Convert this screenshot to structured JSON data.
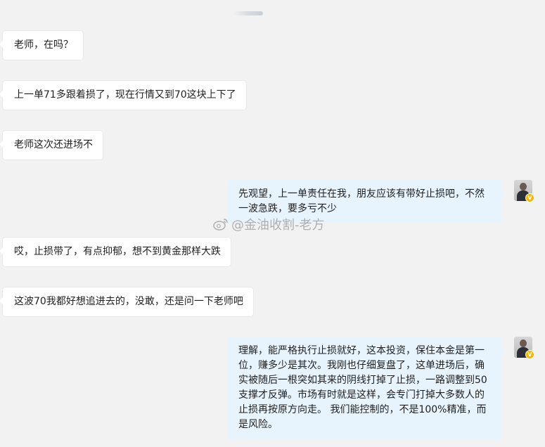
{
  "messages": [
    {
      "side": "left",
      "text": "老师，在吗？"
    },
    {
      "side": "left",
      "text": "上一单71多跟着损了，现在行情又到70这块上下了"
    },
    {
      "side": "left",
      "text": "老师这次还进场不"
    },
    {
      "side": "right",
      "text": "先观望，上一单责任在我，朋友应该有带好止损吧，不然一波急跌，要多亏不少"
    },
    {
      "side": "left",
      "text": "哎，止损带了，有点抑郁，想不到黄金那样大跌"
    },
    {
      "side": "left",
      "text": "这波70我都好想追进去的，没敢，还是问一下老师吧"
    },
    {
      "side": "right",
      "text": "理解，能严格执行止损就好，这本投资，保住本金是第一位，赚多少是其次。我刚也仔细复盘了，这单进场后，确实被随后一根突如其来的阴线打掉了止损，一路调整到50支撑才反弹。市场有时就是这样，会专门打掉大多数人的止损再按原方向走。 我们能控制的，不是100%精准，而是风险。"
    }
  ],
  "watermark": {
    "text": "@金油收割-老方",
    "icon": "weibo-icon"
  },
  "avatar": {
    "verified_badge": "V"
  },
  "colors": {
    "background": "#f2f2f2",
    "incoming_bubble": "#ffffff",
    "outgoing_bubble": "#e7f4fe",
    "badge": "#f5b800"
  }
}
